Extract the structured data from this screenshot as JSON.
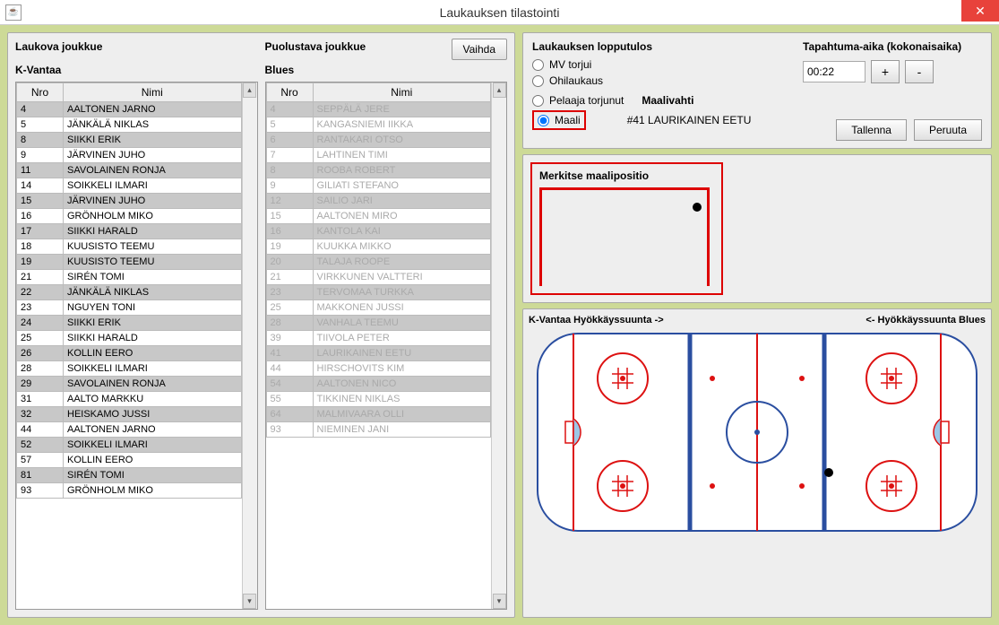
{
  "window": {
    "title": "Laukauksen tilastointi"
  },
  "leftTeam": {
    "header": "Laukova joukkue",
    "name": "K-Vantaa",
    "cols": {
      "nro": "Nro",
      "nimi": "Nimi"
    },
    "rows": [
      {
        "nro": "4",
        "nimi": "AALTONEN JARNO",
        "shaded": true
      },
      {
        "nro": "5",
        "nimi": "JÄNKÄLÄ NIKLAS",
        "shaded": false
      },
      {
        "nro": "8",
        "nimi": "SIIKKI ERIK",
        "shaded": true
      },
      {
        "nro": "9",
        "nimi": "JÄRVINEN JUHO",
        "shaded": false
      },
      {
        "nro": "11",
        "nimi": "SAVOLAINEN RONJA",
        "shaded": true
      },
      {
        "nro": "14",
        "nimi": "SOIKKELI ILMARI",
        "shaded": false
      },
      {
        "nro": "15",
        "nimi": "JÄRVINEN JUHO",
        "shaded": true
      },
      {
        "nro": "16",
        "nimi": "GRÖNHOLM MIKO",
        "shaded": false
      },
      {
        "nro": "17",
        "nimi": "SIIKKI HARALD",
        "shaded": true
      },
      {
        "nro": "18",
        "nimi": "KUUSISTO TEEMU",
        "shaded": false
      },
      {
        "nro": "19",
        "nimi": "KUUSISTO TEEMU",
        "shaded": true
      },
      {
        "nro": "21",
        "nimi": "SIRÉN TOMI",
        "shaded": false
      },
      {
        "nro": "22",
        "nimi": "JÄNKÄLÄ NIKLAS",
        "shaded": true
      },
      {
        "nro": "23",
        "nimi": "NGUYEN TONI",
        "shaded": false
      },
      {
        "nro": "24",
        "nimi": "SIIKKI ERIK",
        "shaded": true
      },
      {
        "nro": "25",
        "nimi": "SIIKKI HARALD",
        "shaded": false
      },
      {
        "nro": "26",
        "nimi": "KOLLIN EERO",
        "shaded": true
      },
      {
        "nro": "28",
        "nimi": "SOIKKELI ILMARI",
        "shaded": false
      },
      {
        "nro": "29",
        "nimi": "SAVOLAINEN RONJA",
        "shaded": true
      },
      {
        "nro": "31",
        "nimi": "AALTO MARKKU",
        "shaded": false
      },
      {
        "nro": "32",
        "nimi": "HEISKAMO JUSSI",
        "shaded": true
      },
      {
        "nro": "44",
        "nimi": "AALTONEN JARNO",
        "shaded": false
      },
      {
        "nro": "52",
        "nimi": "SOIKKELI ILMARI",
        "shaded": true
      },
      {
        "nro": "57",
        "nimi": "KOLLIN EERO",
        "shaded": false
      },
      {
        "nro": "81",
        "nimi": "SIRÉN TOMI",
        "shaded": true
      },
      {
        "nro": "93",
        "nimi": "GRÖNHOLM MIKO",
        "shaded": false
      }
    ]
  },
  "rightTeam": {
    "header": "Puolustava joukkue",
    "name": "Blues",
    "cols": {
      "nro": "Nro",
      "nimi": "Nimi"
    },
    "rows": [
      {
        "nro": "4",
        "nimi": "SEPPÄLÄ JERE",
        "shaded": true,
        "dim": true
      },
      {
        "nro": "5",
        "nimi": "KANGASNIEMI IIKKA",
        "shaded": false,
        "dim": true
      },
      {
        "nro": "6",
        "nimi": "RANTAKARI OTSO",
        "shaded": true,
        "dim": true
      },
      {
        "nro": "7",
        "nimi": "LAHTINEN TIMI",
        "shaded": false,
        "dim": true
      },
      {
        "nro": "8",
        "nimi": "ROOBA ROBERT",
        "shaded": true,
        "dim": true
      },
      {
        "nro": "9",
        "nimi": "GILIATI STEFANO",
        "shaded": false,
        "dim": true
      },
      {
        "nro": "12",
        "nimi": "SAILIO JARI",
        "shaded": true,
        "dim": true
      },
      {
        "nro": "15",
        "nimi": "AALTONEN MIRO",
        "shaded": false,
        "dim": true
      },
      {
        "nro": "16",
        "nimi": "KANTOLA KAI",
        "shaded": true,
        "dim": true
      },
      {
        "nro": "19",
        "nimi": "KUUKKA MIKKO",
        "shaded": false,
        "dim": true
      },
      {
        "nro": "20",
        "nimi": "TALAJA ROOPE",
        "shaded": true,
        "dim": true
      },
      {
        "nro": "21",
        "nimi": "VIRKKUNEN VALTTERI",
        "shaded": false,
        "dim": true
      },
      {
        "nro": "23",
        "nimi": "TERVOMAA TURKKA",
        "shaded": true,
        "dim": true
      },
      {
        "nro": "25",
        "nimi": "MAKKONEN JUSSI",
        "shaded": false,
        "dim": true
      },
      {
        "nro": "28",
        "nimi": "VANHALA TEEMU",
        "shaded": true,
        "dim": true
      },
      {
        "nro": "39",
        "nimi": "TIIVOLA PETER",
        "shaded": false,
        "dim": true
      },
      {
        "nro": "41",
        "nimi": "LAURIKAINEN EETU",
        "shaded": true,
        "dim": true
      },
      {
        "nro": "44",
        "nimi": "HIRSCHOVITS KIM",
        "shaded": false,
        "dim": true
      },
      {
        "nro": "54",
        "nimi": "AALTONEN NICO",
        "shaded": true,
        "dim": true
      },
      {
        "nro": "55",
        "nimi": "TIKKINEN NIKLAS",
        "shaded": false,
        "dim": true
      },
      {
        "nro": "64",
        "nimi": "MALMIVAARA OLLI",
        "shaded": true,
        "dim": true
      },
      {
        "nro": "93",
        "nimi": "NIEMINEN JANI",
        "shaded": false,
        "dim": true
      }
    ]
  },
  "vaihda": "Vaihda",
  "outcome": {
    "legend": "Laukauksen lopputulos",
    "options": {
      "mv": "MV torjui",
      "ohi": "Ohilaukaus",
      "pelaaja": "Pelaaja torjunut",
      "maali": "Maali"
    },
    "goalieLabel": "Maalivahti",
    "goalieName": "#41 LAURIKAINEN EETU",
    "selected": "maali"
  },
  "time": {
    "legend": "Tapahtuma-aika (kokonaisaika)",
    "value": "00:22",
    "plus": "+",
    "minus": "-"
  },
  "actions": {
    "save": "Tallenna",
    "cancel": "Peruuta"
  },
  "goalPos": {
    "label": "Merkitse maalipositio"
  },
  "rink": {
    "left": "K-Vantaa Hyökkäyssuunta ->",
    "right": "<- Hyökkäyssuunta Blues"
  }
}
